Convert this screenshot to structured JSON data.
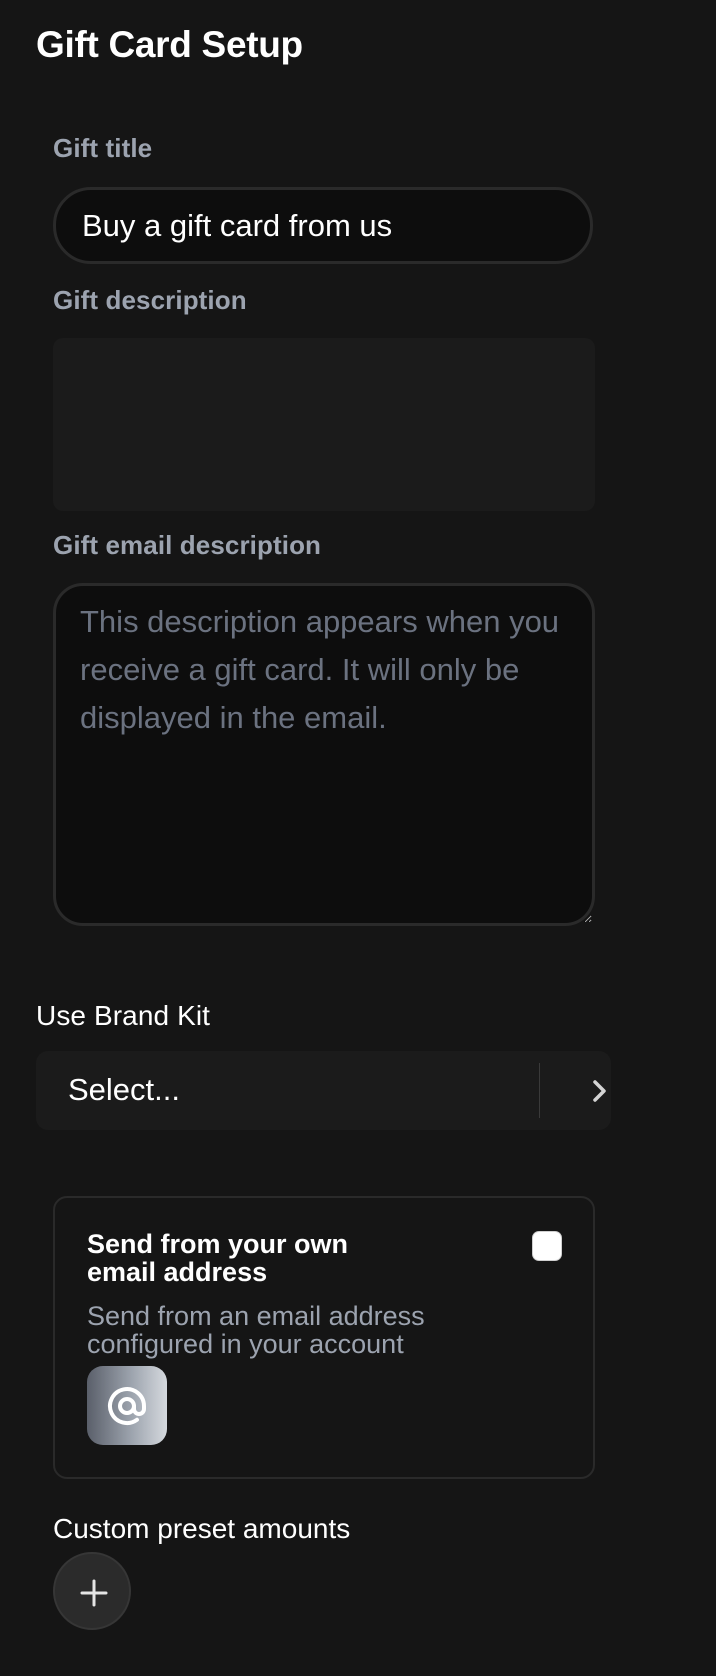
{
  "header": {
    "title": "Gift Card Setup"
  },
  "form": {
    "gift_title": {
      "label": "Gift title",
      "value": "Buy a gift card from us"
    },
    "gift_description": {
      "label": "Gift description",
      "value": ""
    },
    "gift_email_description": {
      "label": "Gift email description",
      "placeholder": "This description appears when you receive a gift card. It will only be displayed in the email.",
      "value": ""
    }
  },
  "brand_kit": {
    "label": "Use Brand Kit",
    "selected": "Select...",
    "icon": "chevron-right-icon"
  },
  "own_email": {
    "title": "Send from your own email address",
    "subtitle": "Send from an email address configured in your account",
    "checked": false,
    "icon": "at-sign-icon"
  },
  "presets": {
    "label": "Custom preset amounts",
    "add_icon": "plus-icon"
  },
  "colors": {
    "background": "#151515",
    "input_background": "#0d0d0d",
    "muted_text": "#9ca3af",
    "placeholder_text": "#6b7280"
  }
}
